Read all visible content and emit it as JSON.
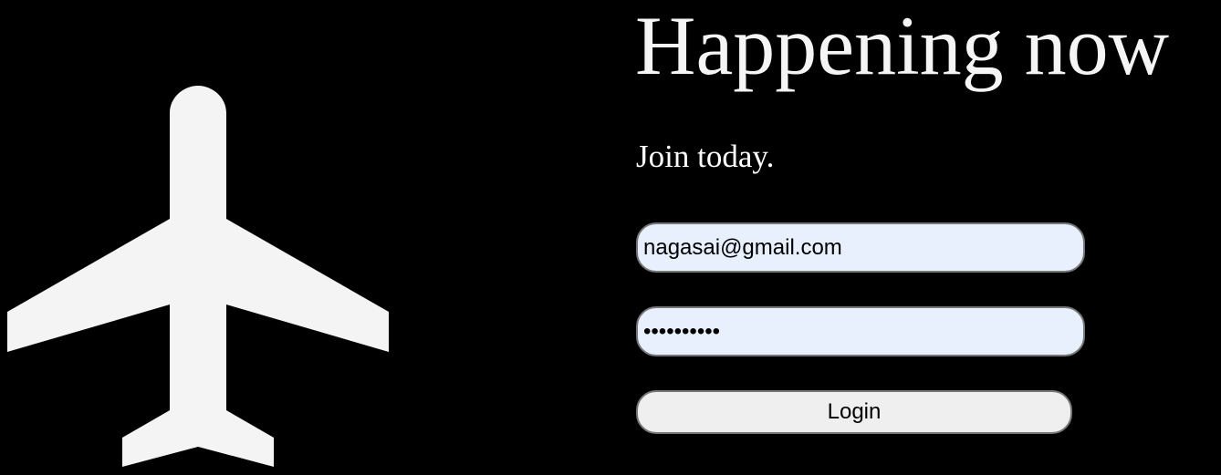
{
  "hero": {
    "icon": "airplane-icon",
    "icon_color": "#f4f4f4"
  },
  "header": {
    "title": "Happening now",
    "subtitle": "Join today."
  },
  "login_form": {
    "email_value": "nagasai@gmail.com",
    "password_value": "1234567890",
    "login_label": "Login"
  },
  "colors": {
    "background": "#000000",
    "input_autofill_bg": "#e8f0fe",
    "button_bg": "#efefef",
    "border": "#767676"
  }
}
